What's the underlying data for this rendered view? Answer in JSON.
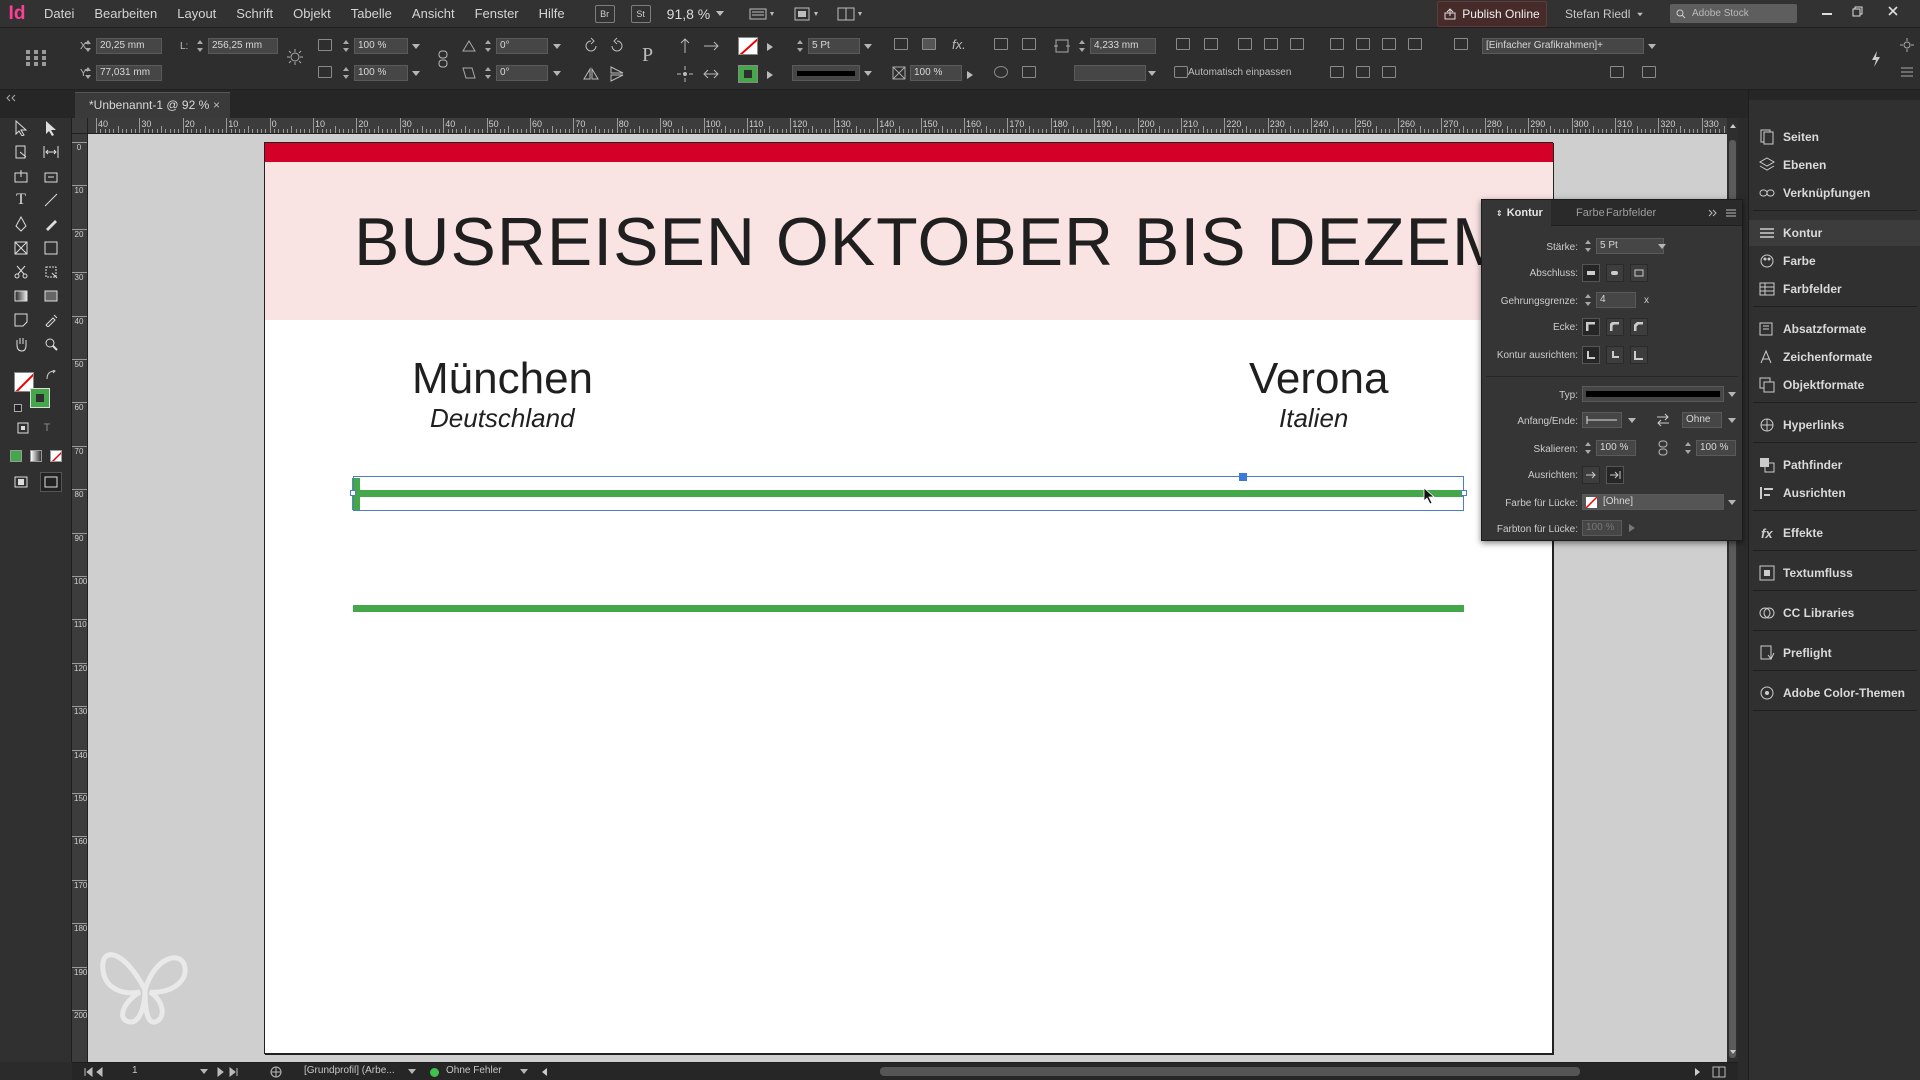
{
  "app": {
    "logo": "Id"
  },
  "menu": [
    "Datei",
    "Bearbeiten",
    "Layout",
    "Schrift",
    "Objekt",
    "Tabelle",
    "Ansicht",
    "Fenster",
    "Hilfe"
  ],
  "menubar": {
    "bridge": "Br",
    "stock_btn": "St",
    "zoom": "91,8 %",
    "publish": "Publish Online",
    "user": "Stefan Riedl",
    "search_placeholder": "Adobe Stock"
  },
  "control": {
    "x_label": "X:",
    "x": "20,25 mm",
    "y_label": "Y:",
    "y": "77,031 mm",
    "l_label": "L:",
    "l": "256,25 mm",
    "scale_x": "100 %",
    "scale_y": "100 %",
    "rotate": "0°",
    "shear": "0°",
    "stroke_weight": "5 Pt",
    "percent": "100 %",
    "offset": "4,233 mm",
    "frame_style": "[Einfacher Grafikrahmen]+",
    "auto_fit": "Automatisch einpassen"
  },
  "document": {
    "tab_title": "*Unbenannt-1 @ 92 %",
    "tab_close": "×"
  },
  "ruler": {
    "h_labels": [
      "40",
      "30",
      "20",
      "10",
      "0",
      "10",
      "20",
      "30",
      "40",
      "50",
      "60",
      "70",
      "80",
      "90",
      "100",
      "110",
      "120",
      "130",
      "140",
      "150",
      "160",
      "170",
      "180",
      "190",
      "200",
      "210",
      "220",
      "230",
      "240",
      "250",
      "260",
      "270",
      "280",
      "290",
      "300",
      "310",
      "320",
      "330"
    ],
    "v_labels": [
      "0",
      "10",
      "20",
      "30",
      "40",
      "50",
      "60",
      "70",
      "80",
      "90",
      "100",
      "110",
      "120",
      "130",
      "140",
      "150",
      "160",
      "170",
      "180",
      "190",
      "200"
    ]
  },
  "page": {
    "title": "BUSREISEN OKTOBER BIS DEZEMBER",
    "city_left": "München",
    "country_left": "Deutschland",
    "city_right": "Verona",
    "country_right": "Italien",
    "colors": {
      "red_bar": "#d40028",
      "pink_band": "#fae3e3",
      "green_line": "#44a84a",
      "selection": "#4d7ccc"
    }
  },
  "kontur_panel": {
    "tabs": [
      "Kontur",
      "Farbe",
      "Farbfelder"
    ],
    "staerke_label": "Stärke:",
    "staerke": "5 Pt",
    "abschluss_label": "Abschluss:",
    "gehrung_label": "Gehrungsgrenze:",
    "gehrung": "4",
    "gehrung_unit": "x",
    "ecke_label": "Ecke:",
    "ausrichten_label": "Kontur ausrichten:",
    "typ_label": "Typ:",
    "anfang_label": "Anfang/Ende:",
    "anfang_end": "Ohne",
    "skalieren_label": "Skalieren:",
    "scale_start": "100 %",
    "scale_end": "100 %",
    "ausrichten2_label": "Ausrichten:",
    "farbe_luecke_label": "Farbe für Lücke:",
    "farbe_luecke": "[Ohne]",
    "farbton_luecke_label": "Farbton für Lücke:",
    "farbton_luecke": "100 %"
  },
  "right_panel": {
    "items": [
      "Seiten",
      "Ebenen",
      "Verknüpfungen",
      "Kontur",
      "Farbe",
      "Farbfelder",
      "Absatzformate",
      "Zeichenformate",
      "Objektformate",
      "Hyperlinks",
      "Pathfinder",
      "Ausrichten",
      "Effekte",
      "Textumfluss",
      "CC Libraries",
      "Preflight",
      "Adobe Color-Themen"
    ]
  },
  "status": {
    "page": "1",
    "profile": "[Grundprofil] (Arbe...",
    "errors": "Ohne Fehler"
  }
}
